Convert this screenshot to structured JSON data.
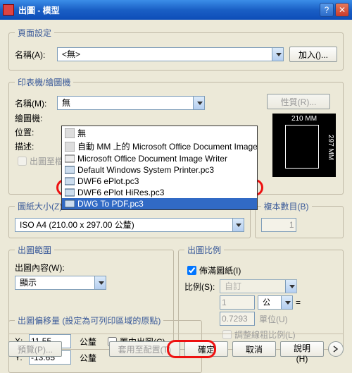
{
  "title": "出圖 - 模型",
  "page_setup": {
    "legend": "頁面設定",
    "name_label": "名稱(A):",
    "name_value": "<無>",
    "add_button": "加入()..."
  },
  "printer": {
    "legend": "印表機/繪圖機",
    "name_label": "名稱(M):",
    "name_value": "無",
    "quality_button": "性質(R)...",
    "plotter_label": "繪圖機:",
    "location_label": "位置:",
    "desc_label": "描述:",
    "plot_to_file": "出圖至檔",
    "options": [
      "無",
      "自動 MM 上的 Microsoft Office Document Image Writ",
      "Microsoft Office Document Image Writer",
      "Default Windows System Printer.pc3",
      "DWF6 ePlot.pc3",
      "DWF6 ePlot HiRes.pc3",
      "DWG To PDF.pc3"
    ],
    "preview_top": "210 MM",
    "preview_side": "297 MM"
  },
  "paper": {
    "legend": "圖紙大小(Z)",
    "value": "ISO A4 (210.00 x 297.00 公釐)"
  },
  "copies": {
    "legend": "複本數目(B)",
    "value": "1"
  },
  "area": {
    "legend": "出圖範圍",
    "content_label": "出圖內容(W):",
    "content_value": "顯示"
  },
  "scale": {
    "legend": "出圖比例",
    "fit_label": "佈滿圖紙(I)",
    "ratio_label": "比例(S):",
    "ratio_value": "自訂",
    "val1": "1",
    "unit": "公釐",
    "eq": "=",
    "val2": "0.7293",
    "unit2_label": "單位(U)",
    "adjust_lw": "調整線粗比例(L)"
  },
  "offset": {
    "legend": "出圖偏移量 (設定為可列印區域的原點)",
    "x_label": "X:",
    "x_value": "11.55",
    "y_label": "Y:",
    "y_value": "-13.65",
    "unit": "公釐",
    "center_label": "置中出圖(C)"
  },
  "footer": {
    "preview": "預覽(P)...",
    "apply": "套用至配置(T)",
    "ok": "確定",
    "cancel": "取消",
    "help": "說明(H)"
  }
}
